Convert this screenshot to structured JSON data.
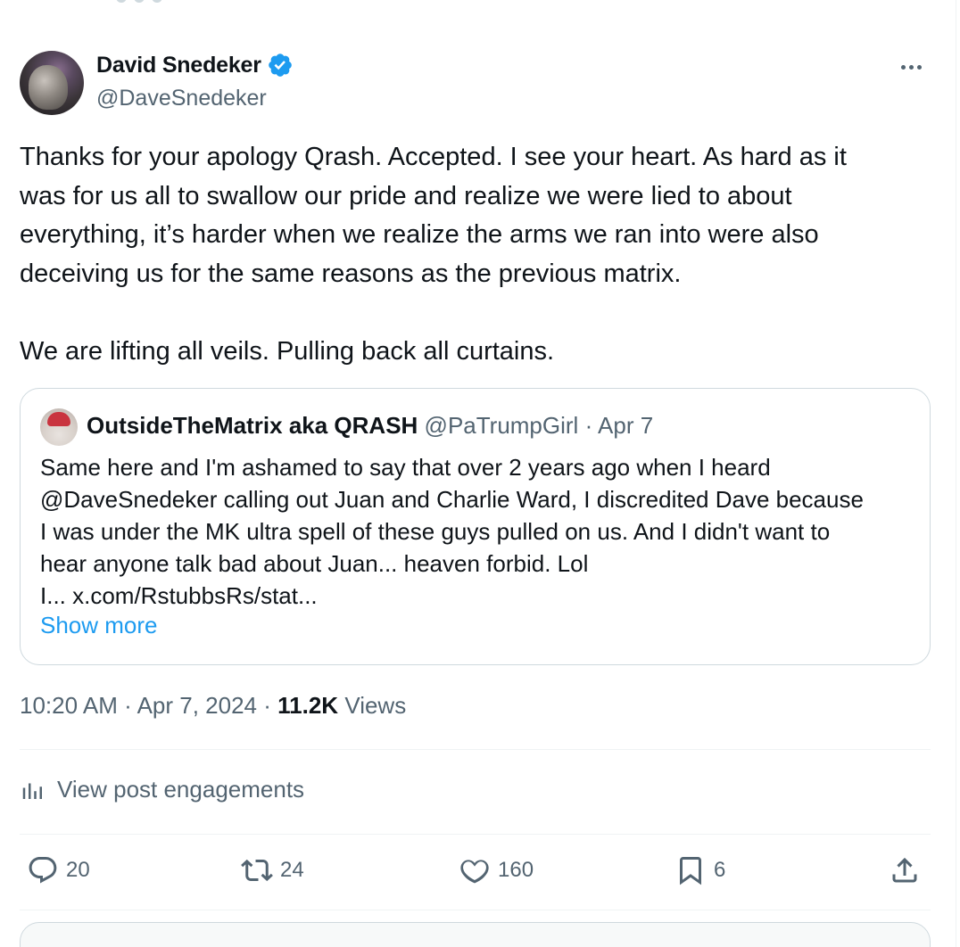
{
  "post": {
    "author_name": "David Snedeker",
    "author_handle": "@DaveSnedeker",
    "text": "Thanks for your apology Qrash. Accepted. I see your heart. As hard as it\nwas for us all to swallow our pride and realize we were lied to about\neverything, it’s harder when we realize the arms we ran into were also\ndeceiving us for the same reasons as the previous matrix.\n\nWe are lifting all veils. Pulling back all curtains.",
    "time": "10:20 AM",
    "date": "Apr 7, 2024",
    "views_count": "11.2K",
    "views_label": "Views",
    "engagements_label": "View post engagements"
  },
  "quote": {
    "name": "OutsideTheMatrix aka QRASH",
    "handle": "@PaTrumpGirl",
    "date": "Apr 7",
    "text": "Same here and I'm ashamed to say that over 2 years ago when I heard\n@DaveSnedeker calling out Juan and Charlie Ward, I discredited Dave because\nI was under the MK ultra spell of these guys pulled on us. And I didn't want to\nhear anyone talk bad about Juan... heaven forbid. Lol\nI... x.com/RstubbsRs/stat...",
    "show_more": "Show more"
  },
  "actions": {
    "replies": "20",
    "reposts": "24",
    "likes": "160",
    "bookmarks": "6"
  },
  "colors": {
    "accent": "#1d9bf0",
    "text": "#0f1419",
    "secondary": "#536471",
    "border": "#cfd9de"
  },
  "icons": [
    "verified-badge-icon",
    "more-options-icon",
    "analytics-icon",
    "reply-icon",
    "repost-icon",
    "like-icon",
    "bookmark-icon",
    "share-icon"
  ]
}
